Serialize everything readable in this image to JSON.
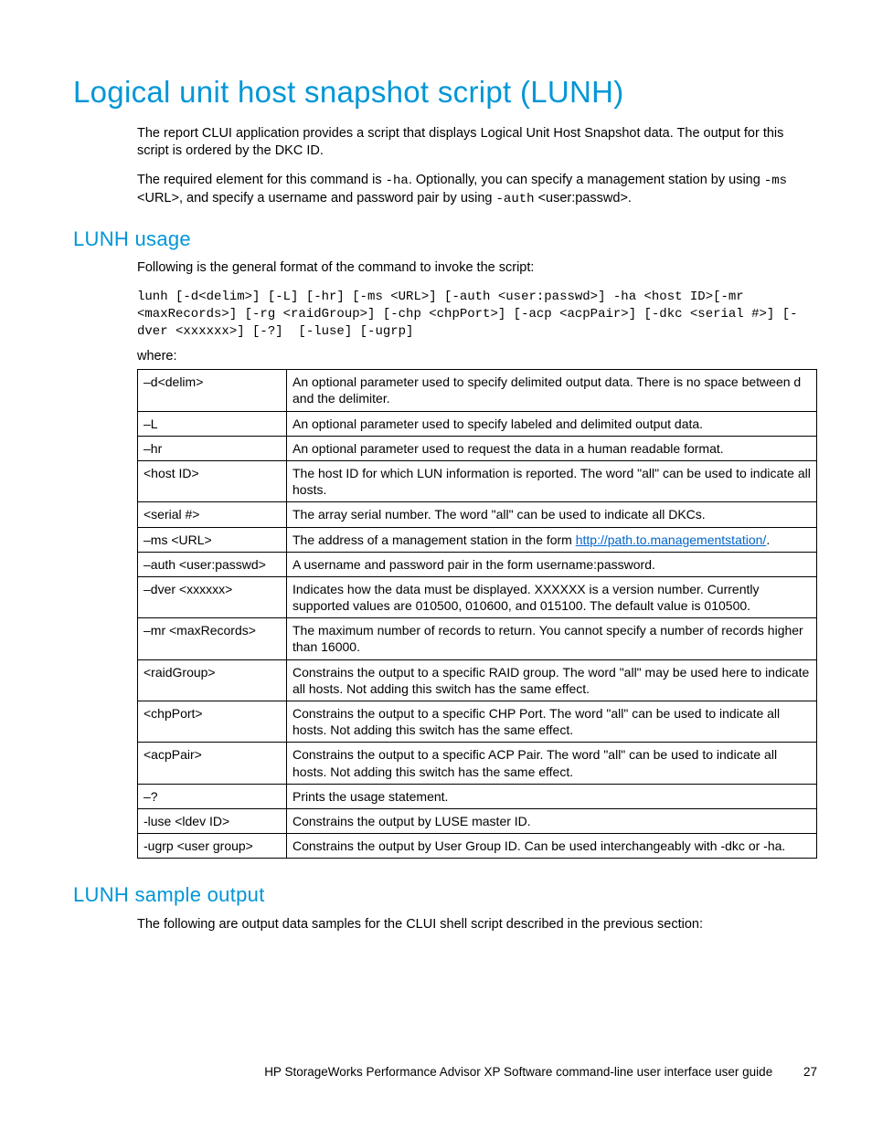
{
  "title": "Logical unit host snapshot script (LUNH)",
  "intro1": "The report CLUI application provides a script that displays Logical Unit Host Snapshot data. The output for this script is ordered by the DKC ID.",
  "intro2a": "The required element for this command is ",
  "intro2_code1": "-ha",
  "intro2b": ". Optionally, you can specify a management station by using ",
  "intro2_code2": "-ms",
  "intro2c": " <URL>, and specify a username and password pair by using ",
  "intro2_code3": "-auth",
  "intro2d": " <user:passwd>.",
  "usage_h": "LUNH usage",
  "usage_intro": "Following is the general format of the command to invoke the script:",
  "usage_code": "lunh [-d<delim>] [-L] [-hr] [-ms <URL>] [-auth <user:passwd>] -ha <host ID>[-mr <maxRecords>] [-rg <raidGroup>] [-chp <chpPort>] [-acp <acpPair>] [-dkc <serial #>] [-dver <xxxxxx>] [-?]  [-luse] [-ugrp]",
  "where": "where:",
  "rows": [
    {
      "p": "–d<delim>",
      "d": "An optional parameter used to specify delimited output data. There is no space between d and the delimiter."
    },
    {
      "p": "–L",
      "d": "An optional parameter used to specify labeled and delimited output data."
    },
    {
      "p": "–hr",
      "d": "An optional parameter used to request the data in a human readable format."
    },
    {
      "p": "<host ID>",
      "d": "The host ID for which LUN information is reported. The word \"all\" can be used to indicate all hosts."
    },
    {
      "p": "<serial #>",
      "d": "The array serial number. The word \"all\" can be used to indicate all DKCs."
    },
    {
      "p": "–ms <URL>",
      "d_pre": "The address of a management station in the form ",
      "link": "http://path.to.managementstation/",
      "d_post": "."
    },
    {
      "p": "–auth <user:passwd>",
      "d": "A username and password pair in the form username:password."
    },
    {
      "p": "–dver <xxxxxx>",
      "d": "Indicates how the data must be displayed. XXXXXX is a version number. Currently supported values are 010500, 010600, and 015100. The default value is 010500."
    },
    {
      "p": "–mr <maxRecords>",
      "d": "The maximum number of records to return. You cannot specify a number of records higher than 16000."
    },
    {
      "p": "<raidGroup>",
      "d": "Constrains the output to a specific RAID group. The word \"all\" may be used here to indicate all hosts. Not adding this switch has the same effect."
    },
    {
      "p": "<chpPort>",
      "d": "Constrains the output to a specific CHP Port. The word \"all\" can be used to indicate all hosts. Not adding this switch has the same effect."
    },
    {
      "p": "<acpPair>",
      "d": "Constrains the output to a specific ACP Pair. The word \"all\" can be used to indicate all hosts. Not adding this switch has the same effect."
    },
    {
      "p": "–?",
      "d": "Prints the usage statement."
    },
    {
      "p": "-luse <ldev ID>",
      "d": "Constrains the output by LUSE master ID."
    },
    {
      "p": "-ugrp <user group>",
      "d": "Constrains the output by User Group ID. Can be used interchangeably with -dkc or -ha."
    }
  ],
  "sample_h": "LUNH sample output",
  "sample_intro": "The following are output data samples for the CLUI shell script described in the previous section:",
  "footer_text": "HP StorageWorks Performance Advisor XP Software command-line user interface user guide",
  "page_number": "27"
}
